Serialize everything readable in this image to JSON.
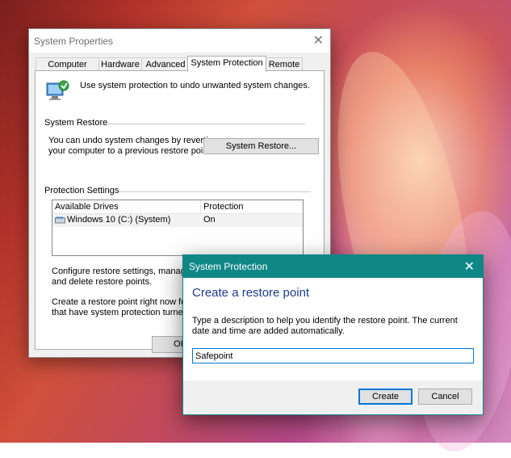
{
  "system_properties": {
    "title": "System Properties",
    "tabs": [
      {
        "label": "Computer Name",
        "active": false
      },
      {
        "label": "Hardware",
        "active": false
      },
      {
        "label": "Advanced",
        "active": false
      },
      {
        "label": "System Protection",
        "active": true
      },
      {
        "label": "Remote",
        "active": false
      }
    ],
    "intro_text": "Use system protection to undo unwanted system changes.",
    "system_restore": {
      "group_title": "System Restore",
      "description_line1": "You can undo system changes by reverting",
      "description_line2": "your computer to a previous restore point.",
      "button_label": "System Restore..."
    },
    "protection_settings": {
      "group_title": "Protection Settings",
      "columns": [
        "Available Drives",
        "Protection"
      ],
      "rows": [
        {
          "drive": "Windows 10 (C:) (System)",
          "protection": "On"
        }
      ],
      "configure_line1": "Configure restore settings, manage di",
      "configure_line2": "and delete restore points.",
      "create_line1": "Create a restore point right now for th",
      "create_line2": "that have system protection turned on"
    },
    "ok_label": "OK"
  },
  "create_dialog": {
    "title": "System Protection",
    "heading": "Create a restore point",
    "description": "Type a description to help you identify the restore point. The current date and time are added automatically.",
    "input_value": "Safepoint",
    "create_label": "Create",
    "cancel_label": "Cancel"
  },
  "colors": {
    "dialog_titlebar": "#0f8787",
    "heading": "#1e3a8a",
    "focus_border": "#0078d7"
  }
}
